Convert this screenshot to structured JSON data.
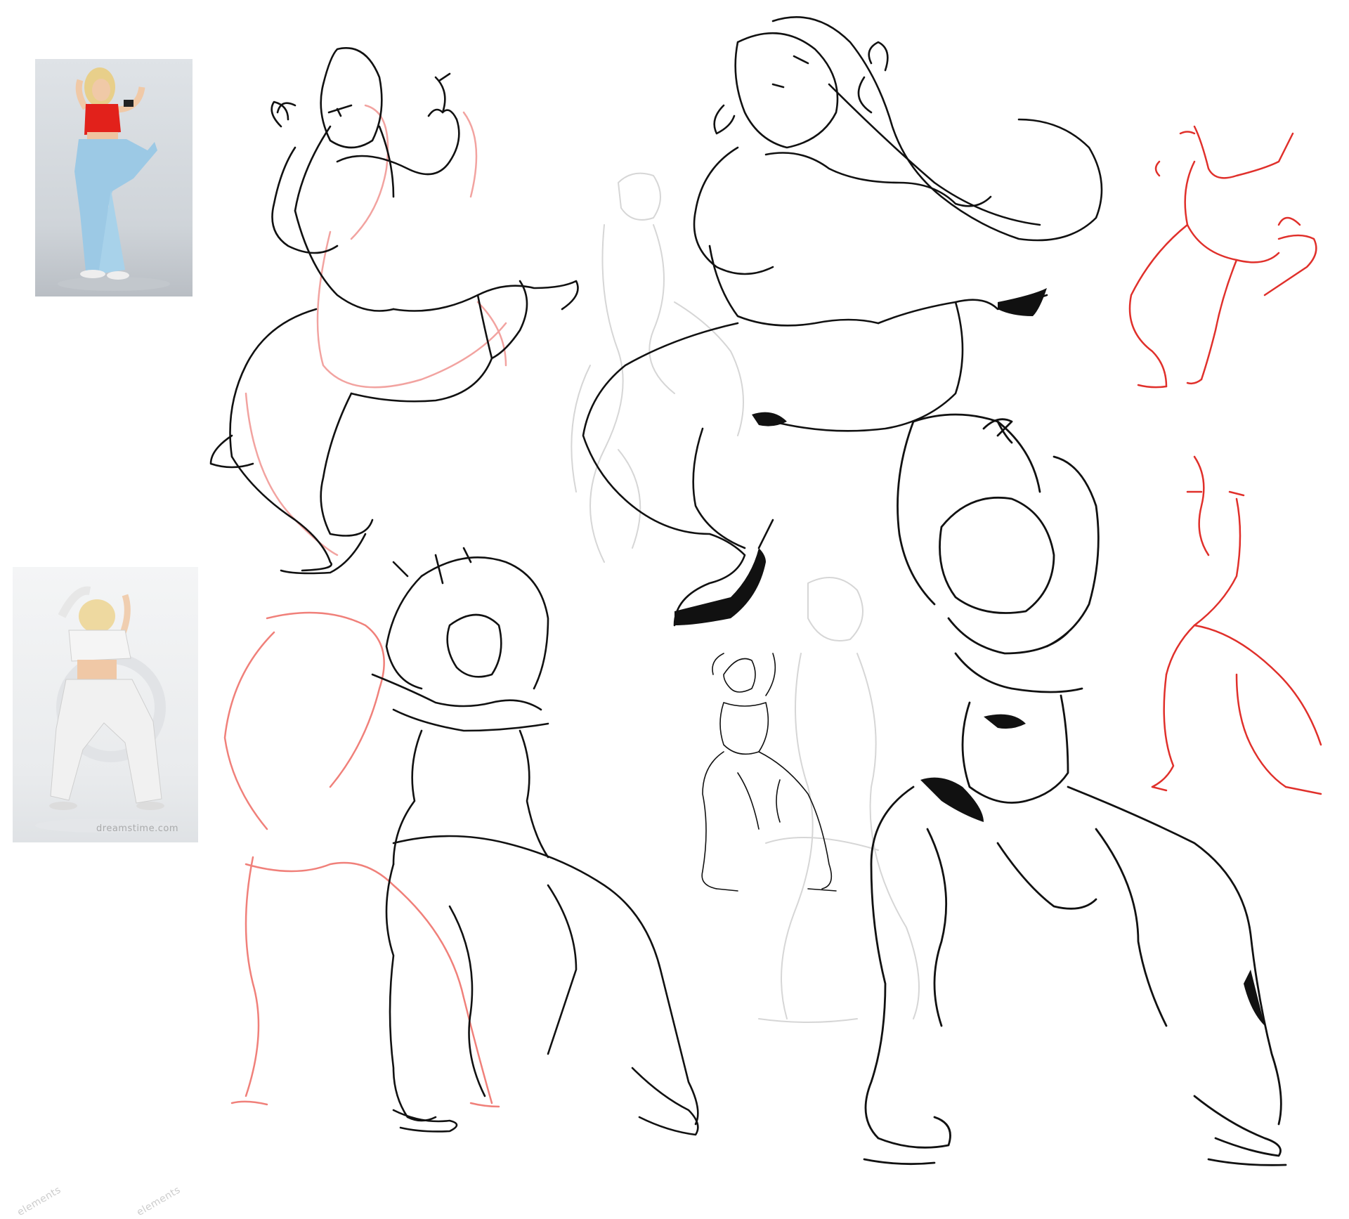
{
  "reference_photos": {
    "photo_red": {
      "subject": "dancer in red top and light blue baggy pants"
    },
    "photo_white": {
      "subject": "dancer in white cropped top and white baggy pants",
      "watermark": "dreamstime.com"
    }
  },
  "bottom_watermarks": [
    "elements",
    "elements"
  ],
  "colors": {
    "ink": "#111111",
    "construction_red": "#e0302b",
    "construction_pink": "#f2a3a0",
    "ghost_grey": "#d6d6d6"
  }
}
